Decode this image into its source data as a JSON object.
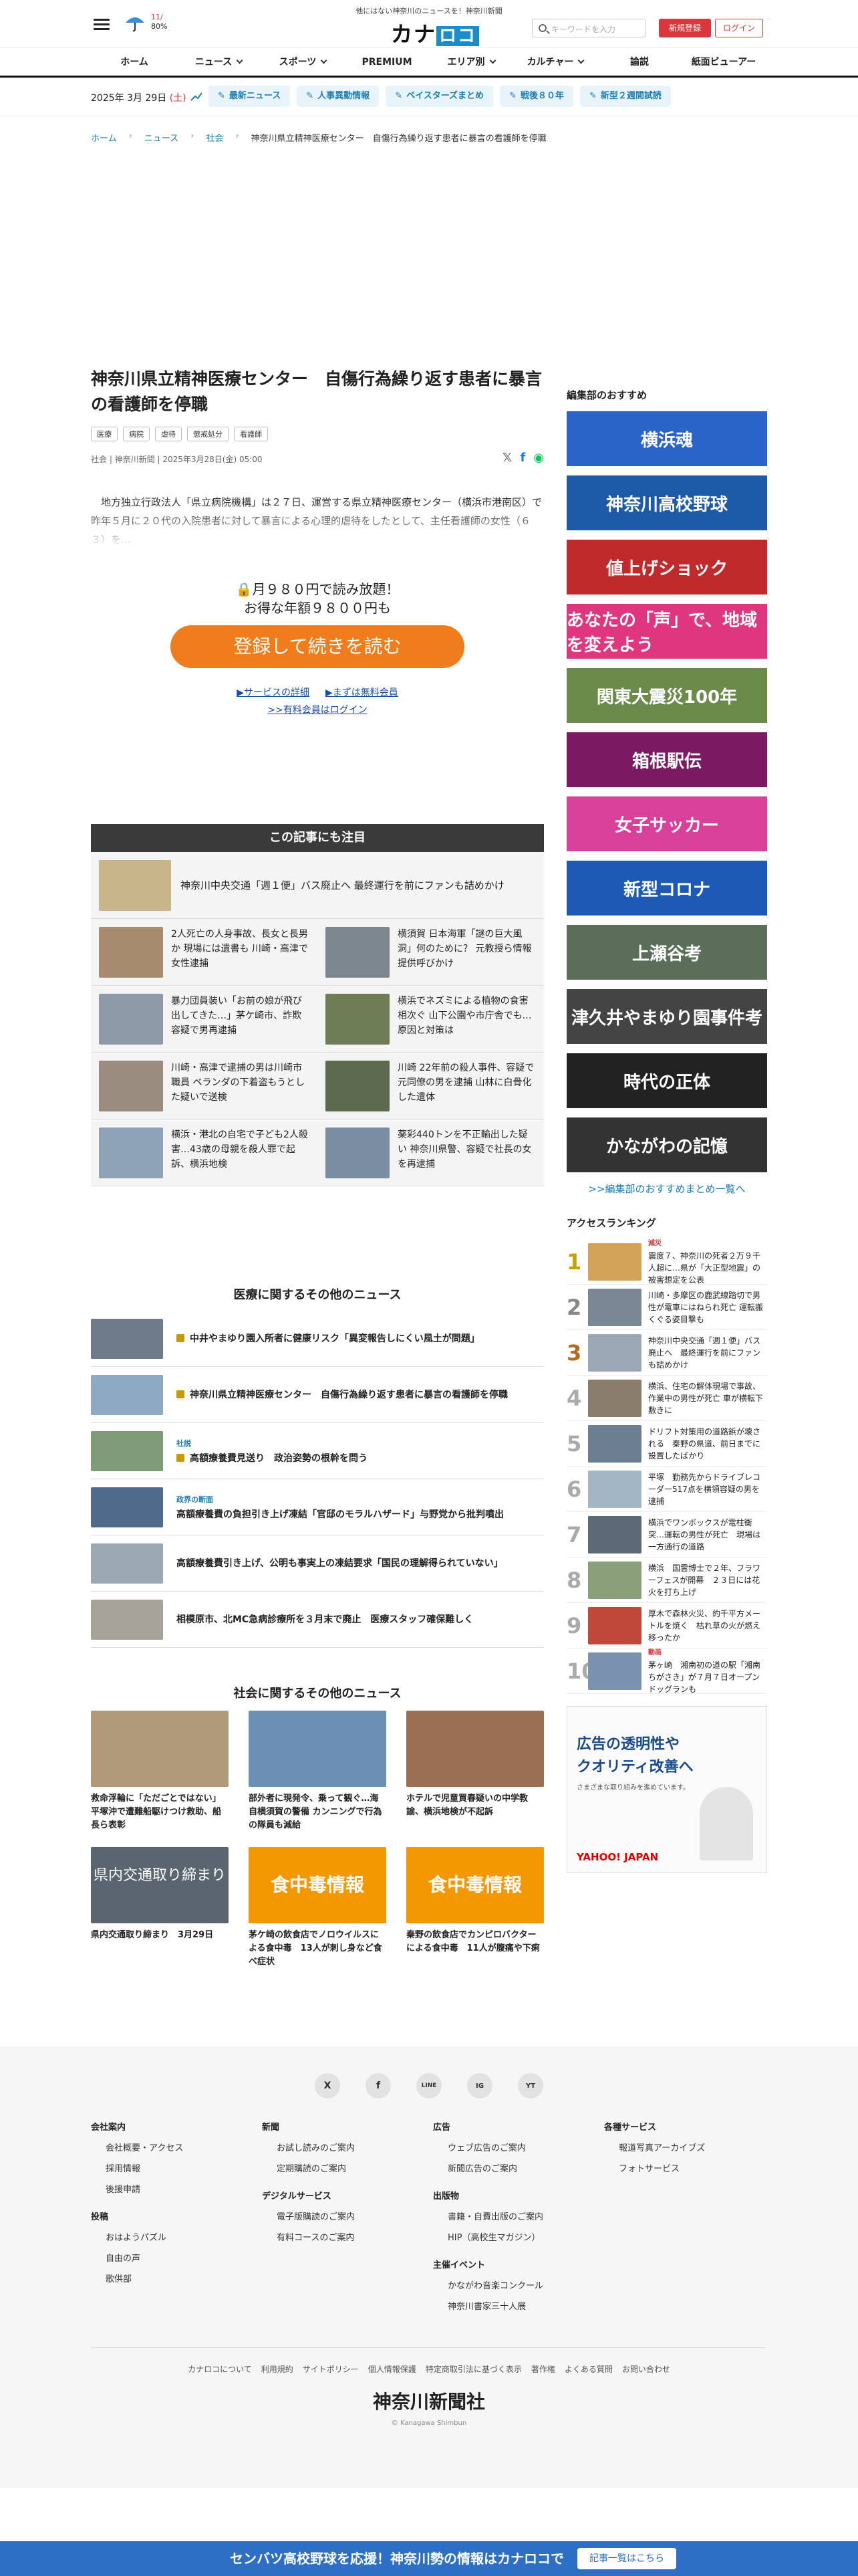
{
  "header": {
    "tagline": "他にはない神奈川のニュースを！神奈川新聞",
    "logo": "カナロコ",
    "logo_prefix": "カナ",
    "logo_suffix": "ロコ",
    "weather_hi": "11/",
    "weather_pct": "80%",
    "search_placeholder": "キーワードを入力",
    "register": "新規登録",
    "login": "ログイン"
  },
  "nav": [
    "ホーム",
    "ニュース",
    "スポーツ",
    "PREMIUM",
    "エリア別",
    "カルチャー",
    "論説",
    "紙面ビューアー"
  ],
  "datebar": {
    "date": "2025年 3月 29日",
    "dow": "(土)",
    "tags": [
      "最新ニュース",
      "人事異動情報",
      "ベイスターズまとめ",
      "戦後８０年",
      "新型２週間試読"
    ]
  },
  "breadcrumb": [
    "ホーム",
    "ニュース",
    "社会",
    "神奈川県立精神医療センター　自傷行為繰り返す患者に暴言の看護師を停職"
  ],
  "article": {
    "title": "神奈川県立精神医療センター　自傷行為繰り返す患者に暴言の看護師を停職",
    "chips": [
      "医療",
      "病院",
      "虐待",
      "懲戒処分",
      "看護師"
    ],
    "meta": "社会 | 神奈川新聞 | 2025年3月28日(金) 05:00",
    "lead": "　地方独立行政法人「県立病院機構」は２７日、運営する県立精神医療センター（横浜市港南区）で昨年５月に２０代の入院患者に対して暴言による心理的虐待をしたとして、主任看護師の女性（６３）を…"
  },
  "paywall": {
    "line1": "🔒月９８０円で読み放題！",
    "line2": "お得な年額９８００円も",
    "button": "登録して続きを読む",
    "link1": "▶サービスの詳細",
    "link2": "▶まずは無料会員",
    "link3": ">>有料会員はログイン"
  },
  "related": {
    "heading": "この記事にも注目",
    "top": "神奈川中央交通「週１便」バス廃止へ 最終運行を前にファンも詰めかけ",
    "items": [
      "2人死亡の人身事故、長女と長男か 現場には遺書も 川崎・高津で女性逮捕",
      "横須賀 日本海軍「謎の巨大風洞」何のために？ 元教授ら情報提供呼びかけ",
      "暴力団員装い「お前の娘が飛び出してきた…」茅ケ崎市、詐欺容疑で男再逮捕",
      "横浜でネズミによる植物の食害相次ぐ 山下公園や市庁舎でも…原因と対策は",
      "川崎・高津で逮捕の男は川崎市職員 ベランダの下着盗もうとした疑いで送検",
      "川崎 22年前の殺人事件、容疑で元同僚の男を逮捕 山林に白骨化した遺体",
      "横浜・港北の自宅で子ども2人殺害…43歳の母親を殺人罪で起訴、横浜地検",
      "薬彩440トンを不正輸出した疑い 神奈川県警、容疑で社長の女を再逮捕"
    ]
  },
  "medical": {
    "heading": "医療に関するその他のニュース",
    "items": [
      {
        "label": "",
        "title": "中井やまゆり園入所者に健康リスク「異変報告しにくい風土が問題」",
        "lock": true
      },
      {
        "label": "",
        "title": "神奈川県立精神医療センター　自傷行為繰り返す患者に暴言の看護師を停職",
        "lock": true
      },
      {
        "label": "社説",
        "title": "高額療養費見送り　政治姿勢の根幹を問う",
        "lock": true
      },
      {
        "label": "政界の断面",
        "title": "高額療養費の負担引き上げ凍結「官邸のモラルハザード」与野党から批判噴出",
        "lock": false
      },
      {
        "label": "",
        "title": "高額療養費引き上げ、公明も事実上の凍結要求「国民の理解得られていない」",
        "lock": false
      },
      {
        "label": "",
        "title": "相模原市、北MC急病診療所を３月末で廃止　医療スタッフ確保難しく",
        "lock": false
      }
    ]
  },
  "society": {
    "heading": "社会に関するその他のニュース",
    "items": [
      {
        "title": "救命浮輪に「ただごとではない」 平塚沖で遭難船駆けつけ救助、船長ら表彰",
        "thumb": ""
      },
      {
        "title": "部外者に現発令、乗って観ぐ…海自横須賀の警備 カンニングで行為の隊員も減給",
        "thumb": ""
      },
      {
        "title": "ホテルで児童買春疑いの中学教諭、横浜地検が不起訴",
        "thumb": ""
      },
      {
        "title": "県内交通取り締まり　3月29日",
        "thumb": "県内交通取り締まり"
      },
      {
        "title": "茅ケ崎の飲食店でノロウイルスによる食中毒　13人が刺し身など食べ症状",
        "thumb": "食中毒情報"
      },
      {
        "title": "秦野の飲食店でカンピロバクターによる食中毒　11人が腹痛や下痢",
        "thumb": "食中毒情報"
      }
    ]
  },
  "sidebar": {
    "heading": "編集部のおすすめ",
    "banners": [
      "横浜魂",
      "神奈川高校野球",
      "値上げショック",
      "あなたの「声」で、地域を変えよう",
      "関東大震災100年",
      "箱根駅伝",
      "女子サッカー",
      "新型コロナ",
      "上瀬谷考",
      "津久井やまゆり園事件考",
      "時代の正体",
      "かながわの記憶"
    ],
    "banner_colors": [
      "#2a64c8",
      "#1d5aa8",
      "#c12a2a",
      "#e0357f",
      "#6b8b4a",
      "#7a1a62",
      "#d8409a",
      "#1d5ab5",
      "#5a6e5a",
      "#444444",
      "#222222",
      "#333333"
    ],
    "more": ">>編集部のおすすめまとめ一覧へ",
    "ranking_heading": "アクセスランキング",
    "ranking": [
      {
        "label": "減災",
        "title": "震度７、神奈川の死者２万９千人超に…県が「大正型地震」の被害想定を公表"
      },
      {
        "label": "",
        "title": "川崎・多摩区の鹿武線踏切で男性が電車にはねられ死亡 運転搬くぐる姿目撃も"
      },
      {
        "label": "",
        "title": "神奈川中央交通「週１便」バス廃止へ　最終運行を前にファンも詰めかけ"
      },
      {
        "label": "",
        "title": "横浜、住宅の解体現場で事故、作業中の男性が死亡 車が横転下敷きに"
      },
      {
        "label": "",
        "title": "ドリフト対策用の道路鋲が壊される　秦野の県道、前日までに設置したばかり"
      },
      {
        "label": "",
        "title": "平塚　勤務先からドライブレコーダー517点を横領容疑の男を逮捕"
      },
      {
        "label": "",
        "title": "横浜でワンボックスが電柱衝突…運転の男性が死亡　現場は一方通行の道路"
      },
      {
        "label": "",
        "title": "横浜　国雲博士で２年、フラワーフェスが開幕　２３日には花火を打ち上げ"
      },
      {
        "label": "",
        "title": "厚木で森林火災、約千平方メートルを焼く　枯れ草の火が燃え移ったか"
      },
      {
        "label": "動画",
        "title": "茅ヶ崎　湘南初の道の駅「湘南ちがさき」が７月７日オープン　ドッグランも"
      }
    ],
    "ad_line1": "広告の透明性や",
    "ad_line2": "クオリティ改善へ",
    "ad_sub": "さまざまな取り組みを進めています。",
    "ad_brand": "YAHOO! JAPAN"
  },
  "footer": {
    "social": [
      "X",
      "f",
      "LINE",
      "IG",
      "YT"
    ],
    "cols": [
      {
        "h": "会社案内",
        "items": [
          "会社概要・アクセス",
          "採用情報",
          "後援申請"
        ]
      },
      {
        "h": "新聞",
        "items": [
          "お試し読みのご案内",
          "定期購読のご案内"
        ]
      },
      {
        "h": "広告",
        "items": [
          "ウェブ広告のご案内",
          "新聞広告のご案内"
        ]
      },
      {
        "h": "各種サービス",
        "items": [
          "報道写真アーカイブズ",
          "フォトサービス"
        ]
      }
    ],
    "cols2": [
      {
        "h": "投稿",
        "items": [
          "おはようパズル",
          "自由の声",
          "歌供部"
        ]
      },
      {
        "h": "デジタルサービス",
        "items": [
          "電子版購読のご案内",
          "有料コースのご案内"
        ]
      },
      {
        "h": "出版物",
        "items": [
          "書籍・自費出版のご案内",
          "HIP（高校生マガジン）"
        ]
      }
    ],
    "cols3": [
      {
        "h": "主催イベント",
        "items": [
          "かながわ音楽コンクール",
          "神奈川書家三十人展"
        ]
      }
    ],
    "links": [
      "カナロコについて",
      "利用規約",
      "サイトポリシー",
      "個人情報保護",
      "特定商取引法に基づく表示",
      "著作権",
      "よくある質問",
      "お問い合わせ"
    ],
    "logo": "神奈川新聞社",
    "copy": "© Kanagawa Shimbun"
  },
  "bottom_banner": {
    "text": "センバツ高校野球を応援！神奈川勢の情報はカナロコで",
    "button": "記事一覧はこちら"
  }
}
